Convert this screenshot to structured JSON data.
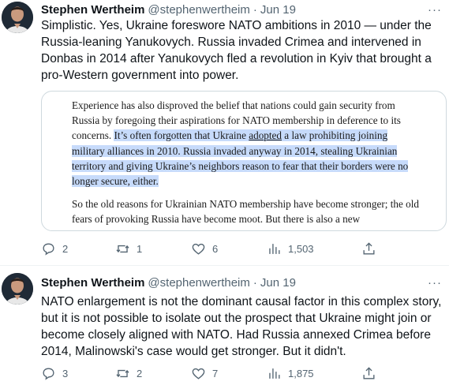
{
  "tweets": [
    {
      "author_name": "Stephen Wertheim",
      "handle": "@stephenwertheim",
      "separator": "·",
      "date": "Jun 19",
      "more_label": "···",
      "text": "Simplistic. Yes, Ukraine foreswore NATO ambitions in 2010 — under the Russia-leaning Yanukovych. Russia invaded Crimea and intervened in Donbas in 2014 after Yanukovych fled a revolution in Kyiv that brought a pro-Western government into power.",
      "quote": {
        "p1_plain": "Experience has also disproved the belief that nations could gain security from Russia by foregoing their aspirations for NATO membership in deference to its concerns. ",
        "p1_hl_a": "It’s often forgotten that Ukraine ",
        "p1_hl_link": "adopted",
        "p1_hl_b": " a law prohibiting joining military alliances in 2010. Russia invaded anyway in 2014, stealing Ukrainian territory and giving Ukraine’s neighbors reason to fear that their borders were no longer secure, either.",
        "p2": "So the old reasons for Ukrainian NATO membership have become stronger; the old fears of provoking Russia have become moot. But there is also a new"
      },
      "stats": {
        "replies": "2",
        "retweets": "1",
        "likes": "6",
        "views": "1,503"
      }
    },
    {
      "author_name": "Stephen Wertheim",
      "handle": "@stephenwertheim",
      "separator": "·",
      "date": "Jun 19",
      "more_label": "···",
      "text": "NATO enlargement is not the dominant causal factor in this complex story, but it is not possible to isolate out the prospect that Ukraine might join or become closely aligned with NATO. Had Russia annexed Crimea before 2014, Malinowski's case would get stronger. But it didn't.",
      "stats": {
        "replies": "3",
        "retweets": "2",
        "likes": "7",
        "views": "1,875"
      }
    }
  ],
  "icons": {
    "reply": "reply-icon",
    "retweet": "retweet-icon",
    "like": "heart-icon",
    "views": "views-icon",
    "share": "share-icon"
  },
  "colors": {
    "secondary_text": "#536471",
    "highlight": "#c7dbfb",
    "border": "#cfd9de"
  }
}
